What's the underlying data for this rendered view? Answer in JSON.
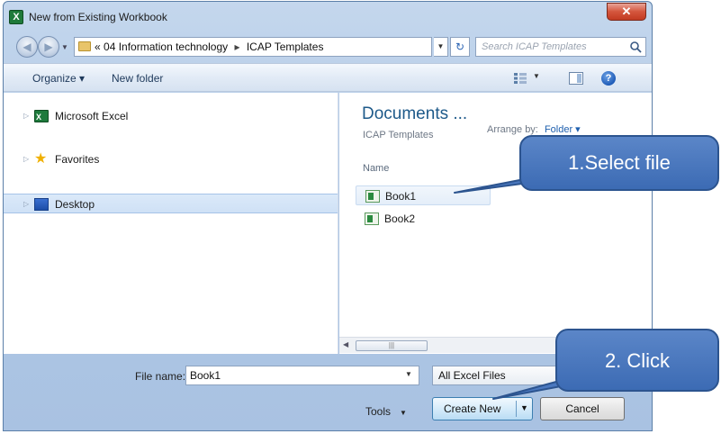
{
  "window": {
    "title": "New from Existing Workbook",
    "close_glyph": "✕"
  },
  "address": {
    "prefix": "«",
    "segments": [
      "04 Information technology",
      "ICAP Templates"
    ],
    "separator": "▸",
    "search_placeholder": "Search ICAP Templates"
  },
  "toolbar": {
    "organize": "Organize ▾",
    "new_folder": "New folder"
  },
  "nav": {
    "items": [
      {
        "label": "Microsoft Excel",
        "icon": "excel-icon"
      },
      {
        "label": "Favorites",
        "icon": "star-icon"
      },
      {
        "label": "Desktop",
        "icon": "desktop-icon",
        "selected": true
      }
    ]
  },
  "library": {
    "title": "Documents ...",
    "subtitle": "ICAP Templates",
    "arrange_label": "Arrange by:",
    "arrange_value": "Folder ▾",
    "column_name": "Name",
    "files": [
      "Book1",
      "Book2"
    ]
  },
  "bottom": {
    "filename_label": "File name:",
    "filename_value": "Book1",
    "filetype": "All Excel Files",
    "tools": "Tools",
    "create_new": "Create New",
    "cancel": "Cancel"
  },
  "callouts": {
    "first": "1.Select file",
    "second": "2. Click"
  },
  "colors": {
    "callout_fill": "#4a78bf",
    "callout_border": "#2c548f",
    "accent": "#1e5a8a"
  }
}
